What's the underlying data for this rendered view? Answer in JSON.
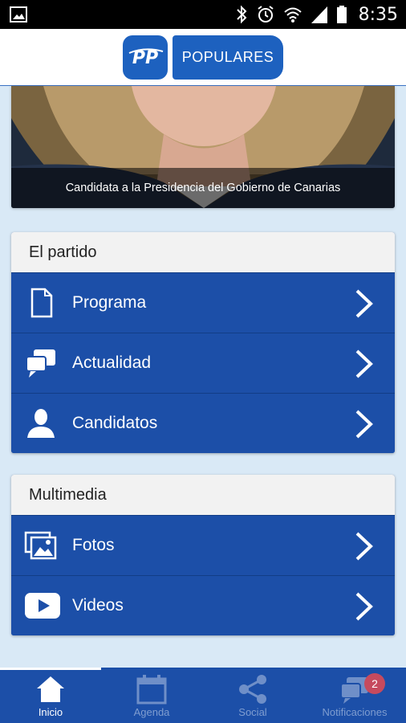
{
  "status_bar": {
    "time": "8:35"
  },
  "header": {
    "logo_mark": "PP",
    "logo_text": "POPULARES"
  },
  "hero": {
    "caption": "Candidata a la Presidencia del Gobierno de Canarias"
  },
  "sections": [
    {
      "title": "El partido",
      "items": [
        {
          "label": "Programa",
          "icon": "document-icon"
        },
        {
          "label": "Actualidad",
          "icon": "chat-bubbles-icon"
        },
        {
          "label": "Candidatos",
          "icon": "person-icon"
        }
      ]
    },
    {
      "title": "Multimedia",
      "items": [
        {
          "label": "Fotos",
          "icon": "photos-icon"
        },
        {
          "label": "Videos",
          "icon": "video-play-icon"
        }
      ]
    }
  ],
  "bottom_nav": {
    "items": [
      {
        "label": "Inicio",
        "icon": "home-icon",
        "active": true
      },
      {
        "label": "Agenda",
        "icon": "calendar-icon",
        "active": false
      },
      {
        "label": "Social",
        "icon": "share-icon",
        "active": false
      },
      {
        "label": "Notificaciones",
        "icon": "notifications-icon",
        "active": false
      }
    ],
    "notification_count": "2"
  },
  "colors": {
    "brand_blue": "#1d61bf",
    "row_blue": "#1c4fa8",
    "page_bg": "#d9e9f6",
    "badge": "#c64a5e"
  }
}
